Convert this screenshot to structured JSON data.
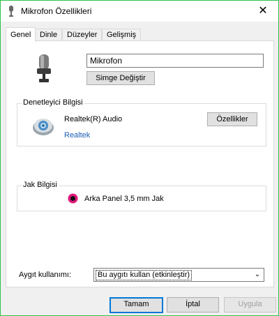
{
  "window": {
    "title": "Mikrofon Özellikleri",
    "close_glyph": "✕"
  },
  "tabs": [
    {
      "label": "Genel",
      "active": true
    },
    {
      "label": "Dinle"
    },
    {
      "label": "Düzeyler"
    },
    {
      "label": "Gelişmiş"
    }
  ],
  "device": {
    "name": "Mikrofon",
    "change_icon_button": "Simge Değiştir"
  },
  "controller": {
    "title": "Denetleyici Bilgisi",
    "name": "Realtek(R) Audio",
    "vendor": "Realtek",
    "properties_button": "Özellikler"
  },
  "jack": {
    "title": "Jak Bilgisi",
    "label": "Arka Panel 3,5 mm Jak",
    "color": "#e0197d"
  },
  "usage": {
    "label": "Aygıt kullanımı:",
    "selected": "Bu aygıtı kullan (etkinleştir)"
  },
  "footer": {
    "ok": "Tamam",
    "cancel": "İptal",
    "apply": "Uygula"
  },
  "colors": {
    "accent": "#0078d7",
    "link": "#1a5fb4",
    "background": "#f0f0f0",
    "border": "#2cd24e"
  },
  "icons": {
    "title": "microphone-icon",
    "device": "microphone-icon",
    "controller": "speaker-icon",
    "jack": "jack-icon",
    "dropdown": "chevron-down-icon"
  }
}
